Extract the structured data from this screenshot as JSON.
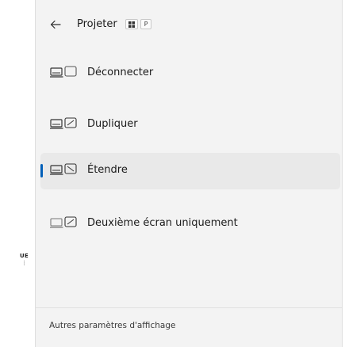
{
  "background_app": {
    "clipped_text": "UE",
    "clipped_dots": "⋮"
  },
  "panel": {
    "title": "Projeter",
    "shortcut_key": "P",
    "back_icon": "arrow-left-icon",
    "options": [
      {
        "label": "Déconnecter",
        "icon": "pc-screen-only-icon",
        "selected": false
      },
      {
        "label": "Dupliquer",
        "icon": "duplicate-icon",
        "selected": false
      },
      {
        "label": "Étendre",
        "icon": "extend-icon",
        "selected": true
      },
      {
        "label": "Deuxième écran uniquement",
        "icon": "second-screen-only-icon",
        "selected": false
      }
    ],
    "footer_link": "Autres paramètres d'affichage",
    "accent_color": "#005fb8"
  }
}
